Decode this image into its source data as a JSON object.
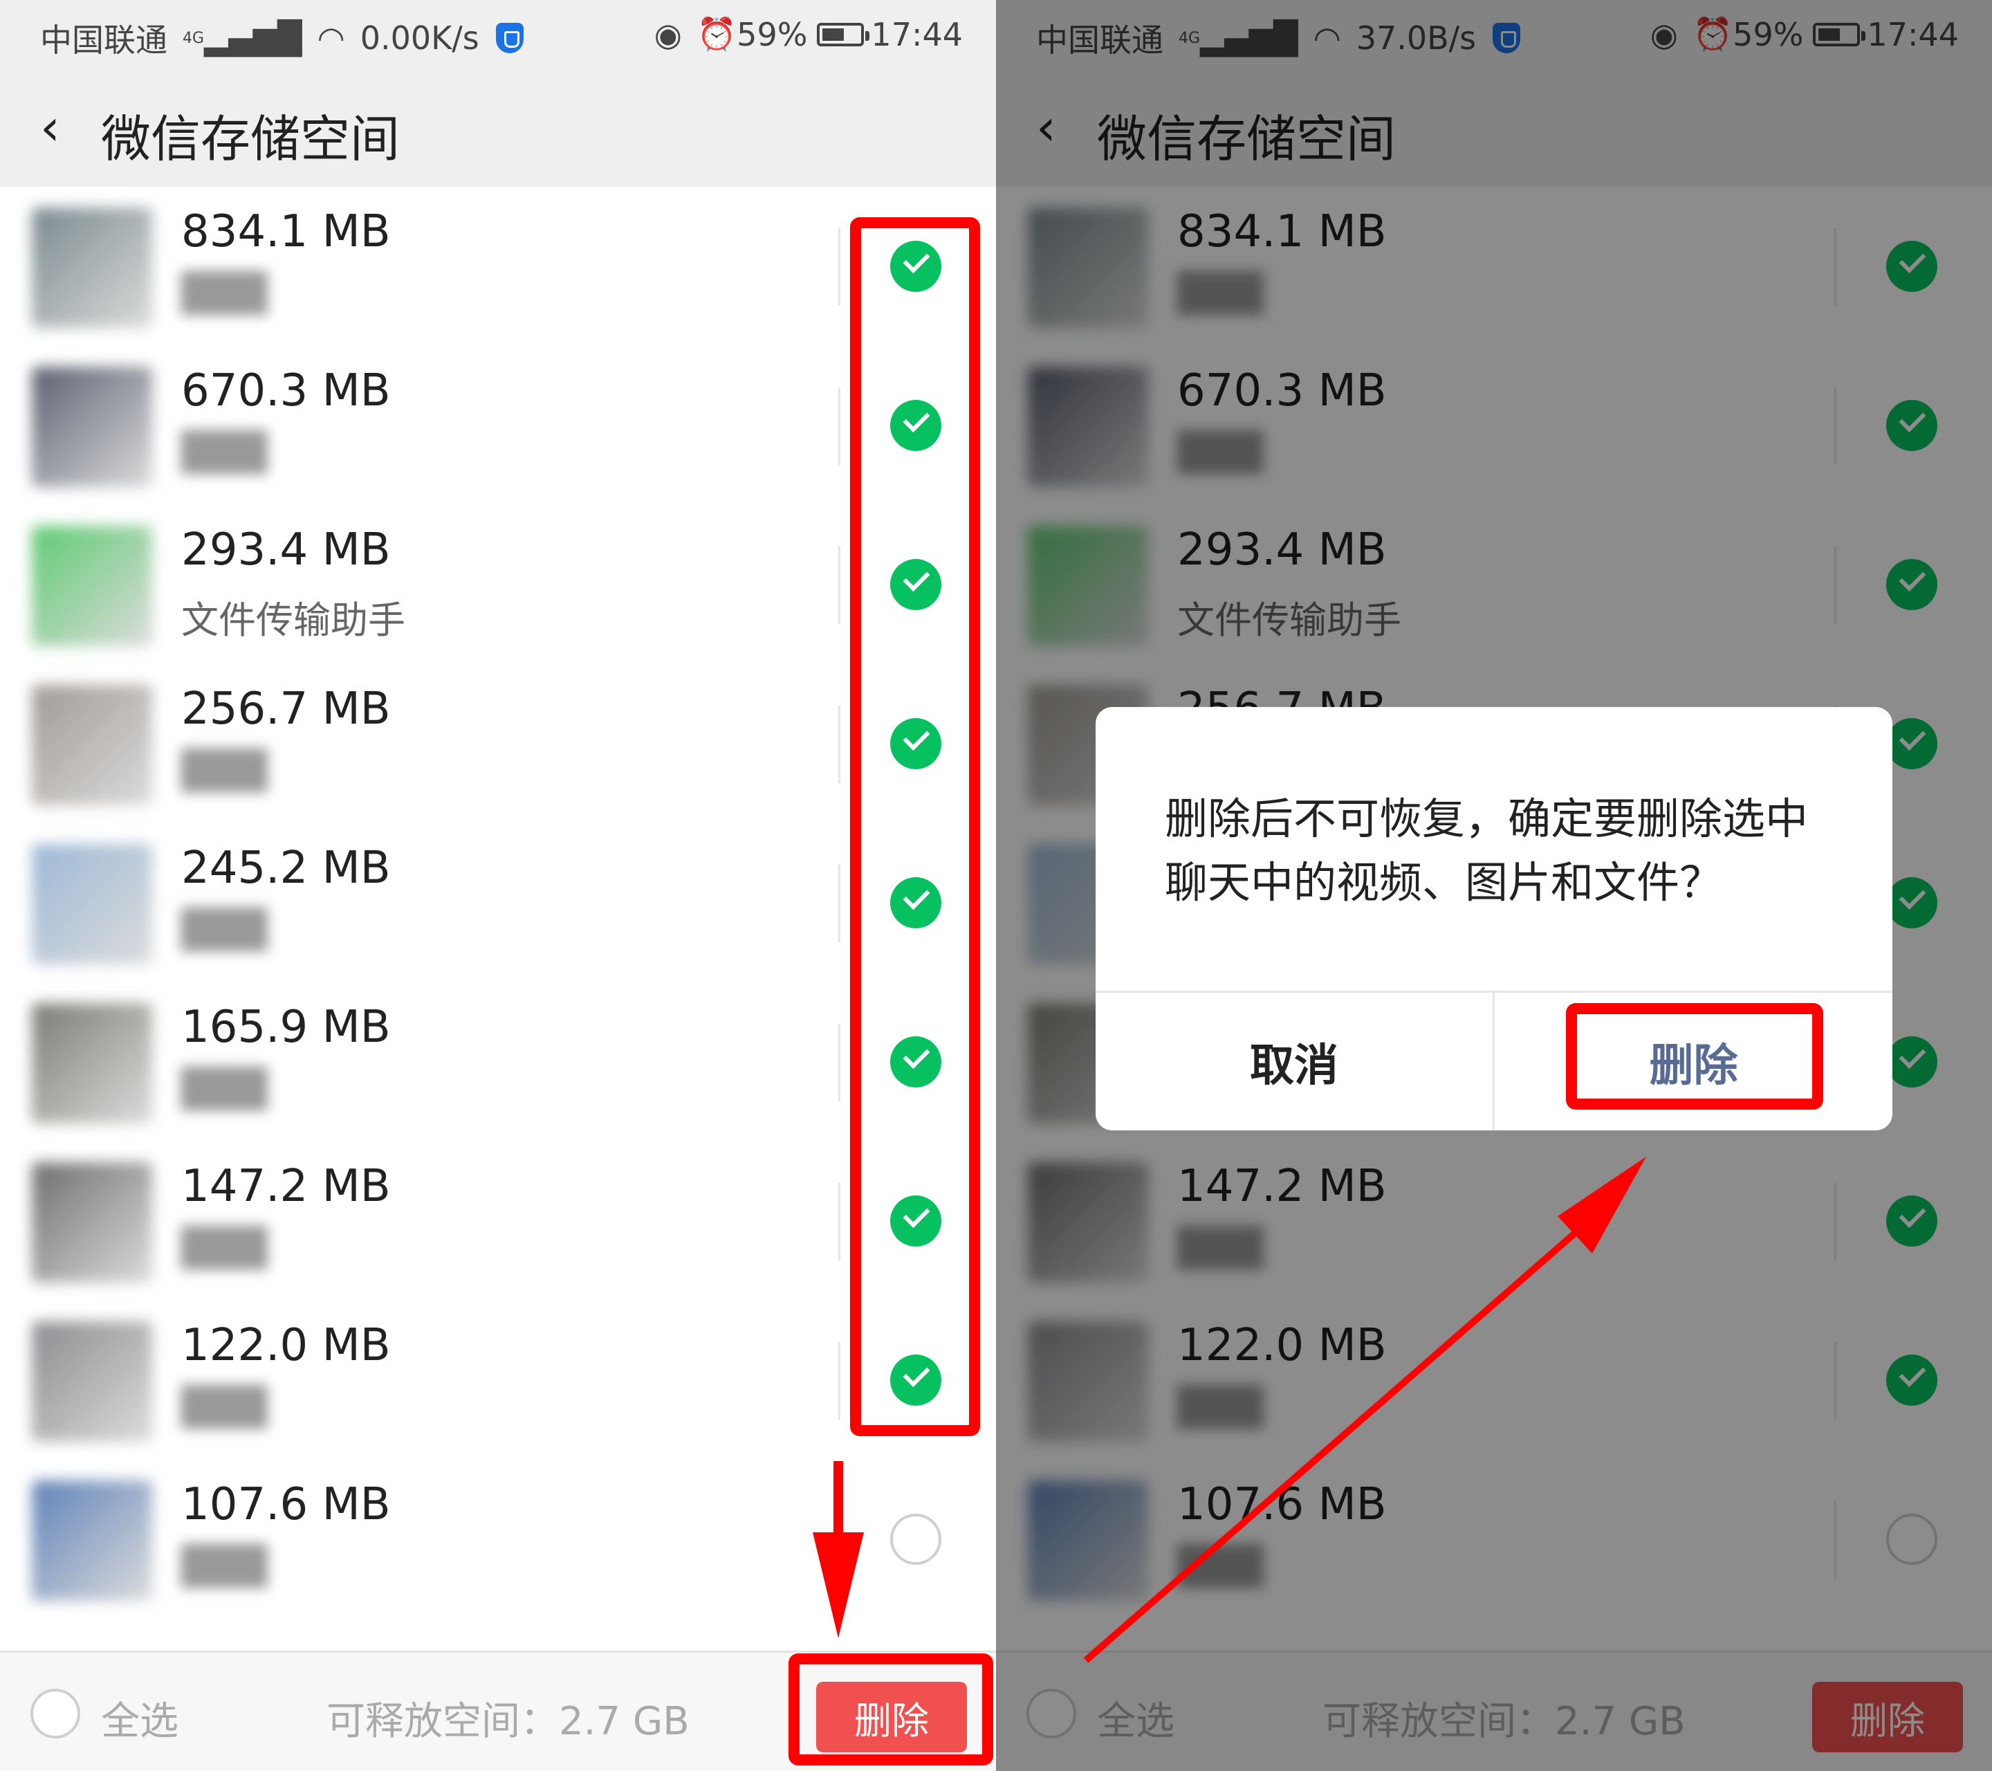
{
  "status_left": {
    "carrier": "中国联通",
    "network": "4G",
    "speed": "0.00K/s",
    "battery": "59%",
    "battery_level": 0.59,
    "time": "17:44"
  },
  "status_right": {
    "carrier": "中国联通",
    "network": "4G",
    "speed": "37.0B/s",
    "battery": "59%",
    "battery_level": 0.59,
    "time": "17:44"
  },
  "header": {
    "back_icon": "chevron-left-icon",
    "title": "微信存储空间"
  },
  "items": [
    {
      "size": "834.1 MB",
      "name": "",
      "name_blurred": true,
      "checked": true,
      "thumb_color": "#7a8a8e"
    },
    {
      "size": "670.3 MB",
      "name": "",
      "name_blurred": true,
      "checked": true,
      "thumb_color": "#5b6070"
    },
    {
      "size": "293.4 MB",
      "name": "文件传输助手",
      "name_blurred": false,
      "checked": true,
      "thumb_color": "#5fca72"
    },
    {
      "size": "256.7 MB",
      "name": "",
      "name_blurred": true,
      "checked": true,
      "thumb_color": "#a09a94"
    },
    {
      "size": "245.2 MB",
      "name": "",
      "name_blurred": true,
      "checked": true,
      "thumb_color": "#9cb8d6"
    },
    {
      "size": "165.9 MB",
      "name": "",
      "name_blurred": true,
      "checked": true,
      "thumb_color": "#7c7c74"
    },
    {
      "size": "147.2 MB",
      "name": "",
      "name_blurred": true,
      "checked": true,
      "thumb_color": "#6e6e6e"
    },
    {
      "size": "122.0 MB",
      "name": "",
      "name_blurred": true,
      "checked": true,
      "thumb_color": "#8c8c90"
    },
    {
      "size": "107.6 MB",
      "name": "",
      "name_blurred": true,
      "checked": false,
      "thumb_color": "#5f82b8"
    }
  ],
  "footer": {
    "select_all": "全选",
    "releasable": "可释放空间：2.7 GB",
    "delete": "删除"
  },
  "dialog": {
    "message": "删除后不可恢复，确定要删除选中聊天中的视频、图片和文件？",
    "cancel": "取消",
    "confirm": "删除"
  },
  "colors": {
    "wechat_green": "#07c160",
    "delete_red": "#f05050",
    "annotation_red": "#ff0000",
    "dialog_link": "#576b95",
    "bar_gray": "#efefef"
  }
}
